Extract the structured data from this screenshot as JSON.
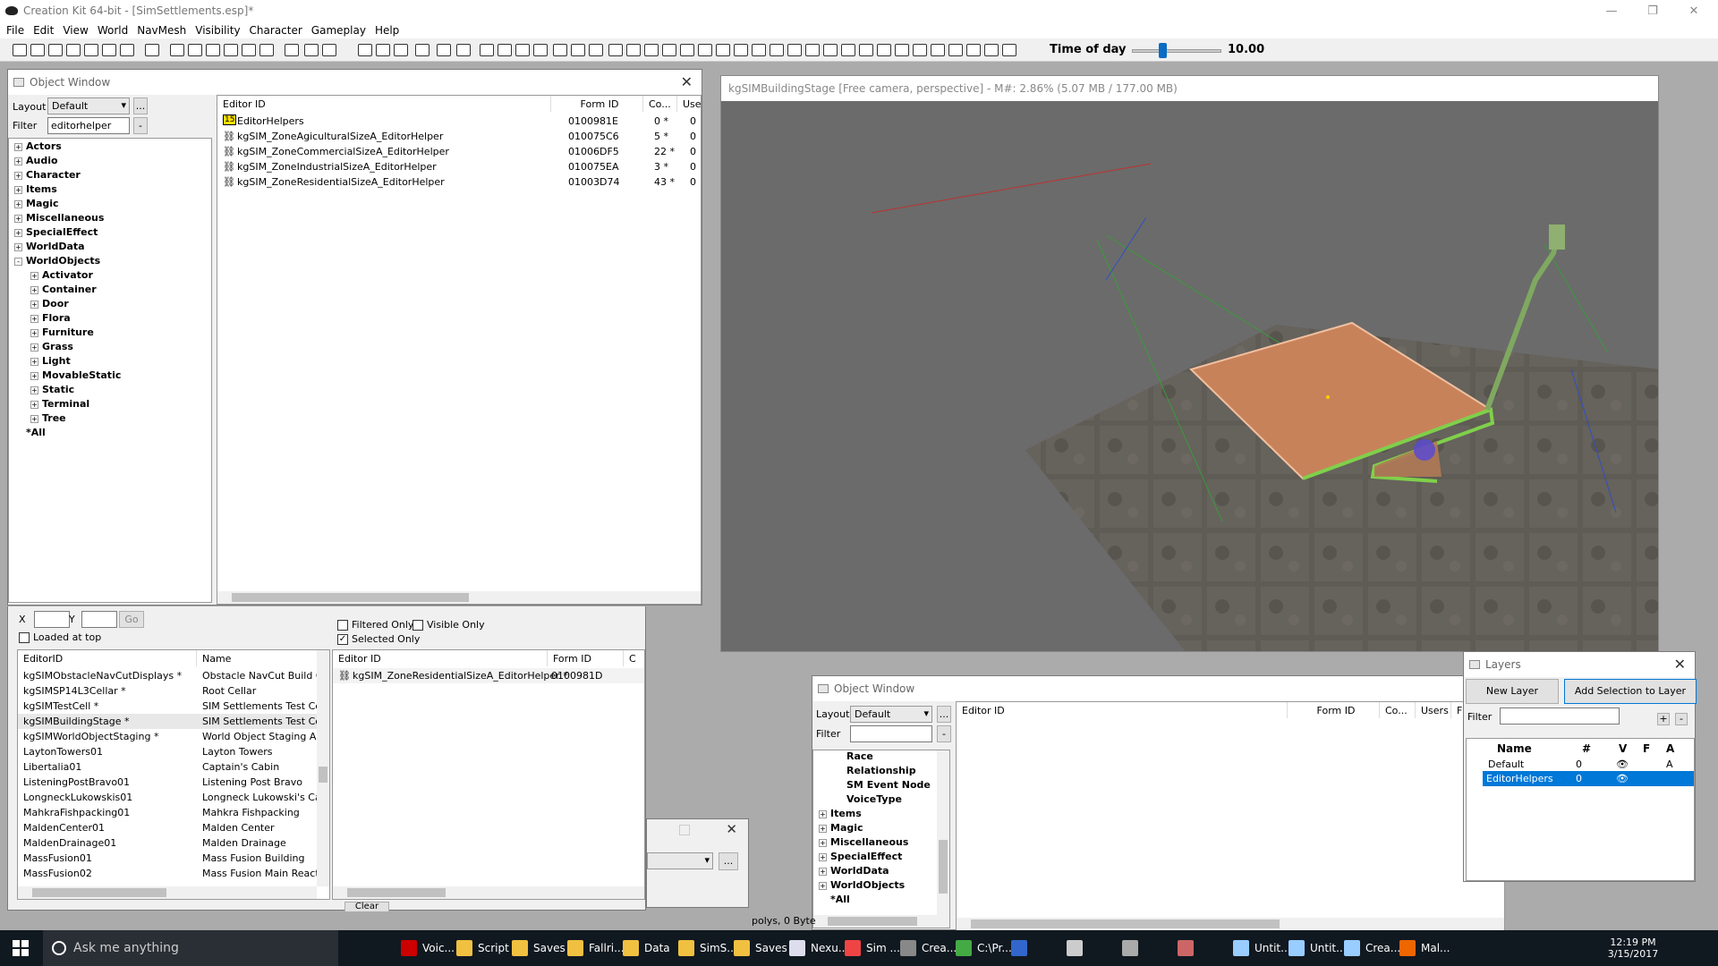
{
  "app": {
    "title": "Creation Kit 64-bit - [SimSettlements.esp]*",
    "menus": [
      "File",
      "Edit",
      "View",
      "World",
      "NavMesh",
      "Visibility",
      "Character",
      "Gameplay",
      "Help"
    ]
  },
  "toolbar": {
    "time_of_day_label": "Time of day",
    "time_of_day_value": "10.00",
    "time_of_day_fraction": 0.3
  },
  "object_window_main": {
    "title": "Object Window",
    "layout_label": "Layout",
    "layout_value": "Default",
    "layout_more": "...",
    "filter_label": "Filter",
    "filter_value": "editorhelper",
    "filter_btn": "-",
    "tree": [
      {
        "label": "Actors",
        "pm": "+",
        "level": 0
      },
      {
        "label": "Audio",
        "pm": "+",
        "level": 0
      },
      {
        "label": "Character",
        "pm": "+",
        "level": 0
      },
      {
        "label": "Items",
        "pm": "+",
        "level": 0
      },
      {
        "label": "Magic",
        "pm": "+",
        "level": 0
      },
      {
        "label": "Miscellaneous",
        "pm": "+",
        "level": 0
      },
      {
        "label": "SpecialEffect",
        "pm": "+",
        "level": 0
      },
      {
        "label": "WorldData",
        "pm": "+",
        "level": 0
      },
      {
        "label": "WorldObjects",
        "pm": "-",
        "level": 0
      },
      {
        "label": "Activator",
        "pm": "+",
        "level": 1
      },
      {
        "label": "Container",
        "pm": "+",
        "level": 1
      },
      {
        "label": "Door",
        "pm": "+",
        "level": 1
      },
      {
        "label": "Flora",
        "pm": "+",
        "level": 1
      },
      {
        "label": "Furniture",
        "pm": "+",
        "level": 1
      },
      {
        "label": "Grass",
        "pm": "+",
        "level": 1
      },
      {
        "label": "Light",
        "pm": "+",
        "level": 1
      },
      {
        "label": "MovableStatic",
        "pm": "+",
        "level": 1
      },
      {
        "label": "Static",
        "pm": "+",
        "level": 1
      },
      {
        "label": "Terminal",
        "pm": "+",
        "level": 1
      },
      {
        "label": "Tree",
        "pm": "+",
        "level": 1
      },
      {
        "label": "*All",
        "pm": "",
        "level": 0
      }
    ],
    "columns": [
      "Editor ID",
      "Form ID",
      "Co...",
      "User"
    ],
    "rows": [
      {
        "editor_id": "EditorHelpers",
        "form_id": "0100981E",
        "count": "0 *",
        "users": "0",
        "icon": "layer"
      },
      {
        "editor_id": "kgSIM_ZoneAgiculturalSizeA_EditorHelper",
        "form_id": "010075C6",
        "count": "5 *",
        "users": "0",
        "icon": "static"
      },
      {
        "editor_id": "kgSIM_ZoneCommercialSizeA_EditorHelper",
        "form_id": "01006DF5",
        "count": "22 *",
        "users": "0",
        "icon": "static"
      },
      {
        "editor_id": "kgSIM_ZoneIndustrialSizeA_EditorHelper",
        "form_id": "010075EA",
        "count": "3 *",
        "users": "0",
        "icon": "static"
      },
      {
        "editor_id": "kgSIM_ZoneResidentialSizeA_EditorHelper",
        "form_id": "01003D74",
        "count": "43 *",
        "users": "0",
        "icon": "static"
      }
    ],
    "layer_icon_text": "15"
  },
  "cell_view": {
    "x_label": "X",
    "y_label": "Y",
    "go_label": "Go",
    "loaded_at_top": "Loaded at top",
    "columns": [
      "EditorID",
      "Name"
    ],
    "rows": [
      {
        "editor_id": "kgSIMObstacleNavCutDisplays *",
        "name": "Obstacle NavCut Build C"
      },
      {
        "editor_id": "kgSIMSP14L3Cellar *",
        "name": "Root Cellar"
      },
      {
        "editor_id": "kgSIMTestCell *",
        "name": "SIM Settlements Test Ce"
      },
      {
        "editor_id": "kgSIMBuildingStage *",
        "name": "SIM Settlements Test Ce"
      },
      {
        "editor_id": "kgSIMWorldObjectStaging *",
        "name": "World Object Staging Ar"
      },
      {
        "editor_id": "LaytonTowers01",
        "name": "Layton Towers"
      },
      {
        "editor_id": "Libertalia01",
        "name": "Captain's Cabin"
      },
      {
        "editor_id": "ListeningPostBravo01",
        "name": "Listening Post Bravo"
      },
      {
        "editor_id": "LongneckLukowskis01",
        "name": "Longneck Lukowski's Ca"
      },
      {
        "editor_id": "MahkraFishpacking01",
        "name": "Mahkra Fishpacking"
      },
      {
        "editor_id": "MaldenCenter01",
        "name": "Malden Center"
      },
      {
        "editor_id": "MaldenDrainage01",
        "name": "Malden Drainage"
      },
      {
        "editor_id": "MassFusion01",
        "name": "Mass Fusion Building"
      },
      {
        "editor_id": "MassFusion02",
        "name": "Mass Fusion Main React"
      }
    ],
    "filtered_only": "Filtered Only",
    "visible_only": "Visible Only",
    "selected_only": "Selected Only",
    "obj_columns": [
      "Editor ID",
      "Form ID",
      "C"
    ],
    "obj_rows": [
      {
        "editor_id": "kgSIM_ZoneResidentialSizeA_EditorHelper *",
        "form_id": "0100981D"
      }
    ],
    "clear_label": "Clear"
  },
  "render_window": {
    "title": "kgSIMBuildingStage [Free camera, perspective] - M#: 2.86% (5.07 MB / 177.00 MB)"
  },
  "object_window_second": {
    "title": "Object Window",
    "layout_label": "Layout",
    "layout_value": "Default",
    "layout_more": "...",
    "filter_label": "Filter",
    "filter_btn": "-",
    "tree": [
      {
        "label": "Race",
        "pm": "",
        "level": 1
      },
      {
        "label": "Relationship",
        "pm": "",
        "level": 1
      },
      {
        "label": "SM Event Node",
        "pm": "",
        "level": 1
      },
      {
        "label": "VoiceType",
        "pm": "",
        "level": 1
      },
      {
        "label": "Items",
        "pm": "+",
        "level": 0
      },
      {
        "label": "Magic",
        "pm": "+",
        "level": 0
      },
      {
        "label": "Miscellaneous",
        "pm": "+",
        "level": 0
      },
      {
        "label": "SpecialEffect",
        "pm": "+",
        "level": 0
      },
      {
        "label": "WorldData",
        "pm": "+",
        "level": 0
      },
      {
        "label": "WorldObjects",
        "pm": "+",
        "level": 0
      },
      {
        "label": "*All",
        "pm": "",
        "level": 0
      }
    ],
    "columns": [
      "Editor ID",
      "Form ID",
      "Co...",
      "Users",
      "F"
    ]
  },
  "layers": {
    "title": "Layers",
    "new_layer": "New Layer",
    "add_selection": "Add Selection to Layer",
    "filter_label": "Filter",
    "plus": "+",
    "minus": "-",
    "columns": [
      "Name",
      "#",
      "V",
      "F",
      "A"
    ],
    "rows": [
      {
        "name": "Default",
        "count": "0",
        "a": "A",
        "selected": false
      },
      {
        "name": "EditorHelpers",
        "count": "0",
        "a": "",
        "selected": true
      }
    ]
  },
  "status_bar": {
    "text": "polys, 0 Byte"
  },
  "taskbar": {
    "search_placeholder": "Ask me anything",
    "items": [
      "Voic...",
      "Script",
      "Saves",
      "Fallri...",
      "Data",
      "SimS...",
      "Saves",
      "Nexu...",
      "Sim ...",
      "Crea...",
      "C:\\Pr...",
      "",
      "",
      "",
      "",
      "Untit...",
      "Untit...",
      "Crea...",
      "Mal..."
    ],
    "time": "12:19 PM",
    "date": "3/15/2017"
  },
  "colors": {
    "accent": "#0078d7",
    "platform": "#c8825a",
    "taskbar": "#101820"
  }
}
